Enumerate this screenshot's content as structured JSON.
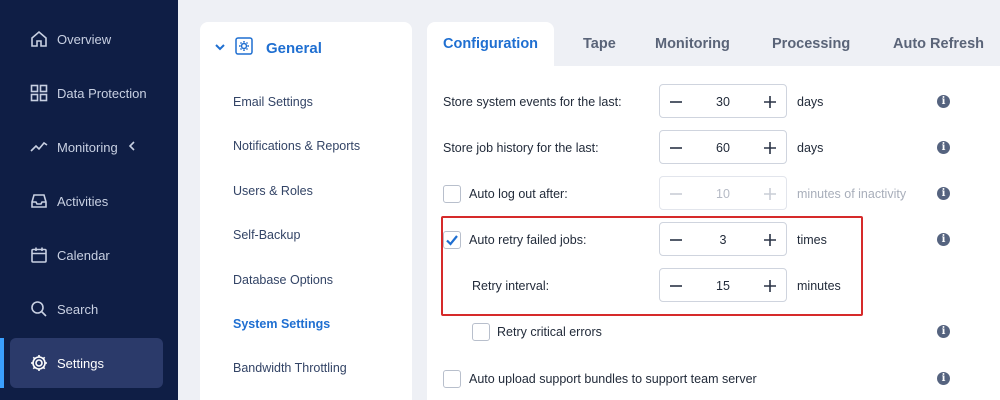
{
  "sidebar": {
    "items": [
      {
        "label": "Overview",
        "icon": "home-icon"
      },
      {
        "label": "Data Protection",
        "icon": "grid-icon"
      },
      {
        "label": "Monitoring",
        "icon": "activity-line-icon"
      },
      {
        "label": "Activities",
        "icon": "inbox-icon"
      },
      {
        "label": "Calendar",
        "icon": "calendar-icon"
      },
      {
        "label": "Search",
        "icon": "search-icon"
      },
      {
        "label": "Settings",
        "icon": "gear-icon"
      }
    ],
    "active": "Settings"
  },
  "middle": {
    "title": "General",
    "items": [
      "Email Settings",
      "Notifications & Reports",
      "Users & Roles",
      "Self-Backup",
      "Database Options",
      "System Settings",
      "Bandwidth Throttling"
    ],
    "active": "System Settings"
  },
  "tabs": {
    "items": [
      "Configuration",
      "Tape",
      "Monitoring",
      "Processing",
      "Auto Refresh"
    ],
    "active": "Configuration"
  },
  "settings": {
    "events": {
      "label": "Store system events for the last:",
      "value": "30",
      "unit": "days"
    },
    "history": {
      "label": "Store job history for the last:",
      "value": "60",
      "unit": "days"
    },
    "logout": {
      "label": "Auto log out after:",
      "value": "10",
      "unit": "minutes of inactivity",
      "checked": false
    },
    "retry": {
      "label": "Auto retry failed jobs:",
      "value": "3",
      "unit": "times",
      "checked": true
    },
    "interval": {
      "label": "Retry interval:",
      "value": "15",
      "unit": "minutes"
    },
    "critical": {
      "label": "Retry critical errors",
      "checked": false
    },
    "upload": {
      "label": "Auto upload support bundles to support team server",
      "checked": false
    }
  },
  "colors": {
    "sidebar_bg": "#0f1e45",
    "accent": "#1f6fd1",
    "highlight": "#d62a2a"
  }
}
